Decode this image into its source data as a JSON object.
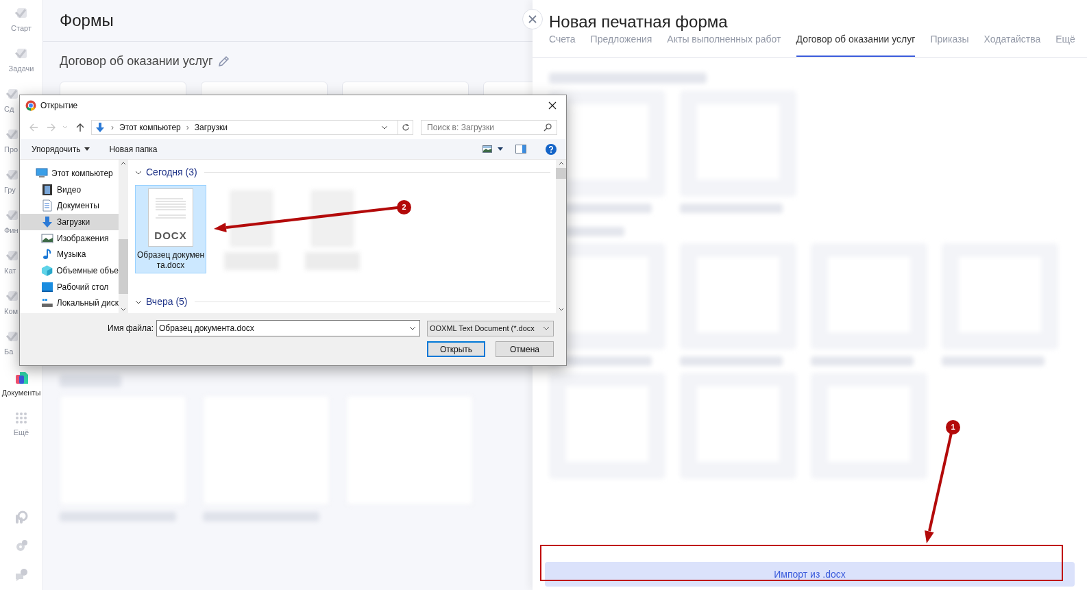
{
  "sidebar": {
    "items": [
      {
        "label": "Старт",
        "kind": "full",
        "selected": false
      },
      {
        "label": "Задачи",
        "kind": "full",
        "selected": false
      },
      {
        "label": "Сд",
        "kind": "cut",
        "selected": false
      },
      {
        "label": "Про",
        "kind": "cut",
        "selected": false
      },
      {
        "label": "Гру",
        "kind": "cut",
        "selected": false
      },
      {
        "label": "Фин",
        "kind": "cut",
        "selected": false
      },
      {
        "label": "Кат",
        "kind": "cut",
        "selected": false
      },
      {
        "label": "Ком",
        "kind": "cut",
        "selected": false
      },
      {
        "label": "Ба",
        "kind": "cut",
        "selected": false
      },
      {
        "label": "Документы",
        "kind": "full",
        "selected": true
      },
      {
        "label": "Ещё",
        "kind": "full",
        "selected": false
      }
    ]
  },
  "page": {
    "title": "Формы",
    "section_title": "Договор об оказании услуг"
  },
  "panel": {
    "title": "Новая печатная форма",
    "tabs": [
      {
        "label": "Счета",
        "selected": false
      },
      {
        "label": "Предложения",
        "selected": false
      },
      {
        "label": "Акты выполненных работ",
        "selected": false
      },
      {
        "label": "Договор об оказании услуг",
        "selected": true
      },
      {
        "label": "Приказы",
        "selected": false
      },
      {
        "label": "Ходатайства",
        "selected": false
      },
      {
        "label": "Ещё",
        "selected": false
      }
    ],
    "import_button": "Импорт из .docx"
  },
  "dialog": {
    "title": "Открытие",
    "path": [
      "Этот компьютер",
      "Загрузки"
    ],
    "path_separator": "›",
    "search": {
      "placeholder": "Поиск в: Загрузки"
    },
    "toolbar": [
      "Упорядочить",
      "Новая папка"
    ],
    "nav": [
      {
        "label": "Этот компьютер",
        "selected": false,
        "children": [
          {
            "label": "Видео",
            "selected": false
          },
          {
            "label": "Документы",
            "selected": false
          },
          {
            "label": "Загрузки",
            "selected": true
          },
          {
            "label": "Изображения",
            "selected": false
          },
          {
            "label": "Музыка",
            "selected": false
          },
          {
            "label": "Объемные объе",
            "selected": false
          },
          {
            "label": "Рабочий стол",
            "selected": false
          },
          {
            "label": "Локальный диск",
            "selected": false
          }
        ]
      }
    ],
    "groups": [
      {
        "label": "Сегодня (3)",
        "expanded": true
      },
      {
        "label": "Вчера (5)",
        "expanded": true
      }
    ],
    "file": {
      "name": "Образец документа.docx",
      "type_label": "DOCX",
      "selected": true
    },
    "filename_label": "Имя файла:",
    "filename": "Образец документа.docx",
    "filter": "OOXML Text Document (*.docx",
    "buttons": [
      "Открыть",
      "Отмена"
    ]
  },
  "annotations": [
    {
      "number": "2"
    },
    {
      "number": "1"
    }
  ]
}
